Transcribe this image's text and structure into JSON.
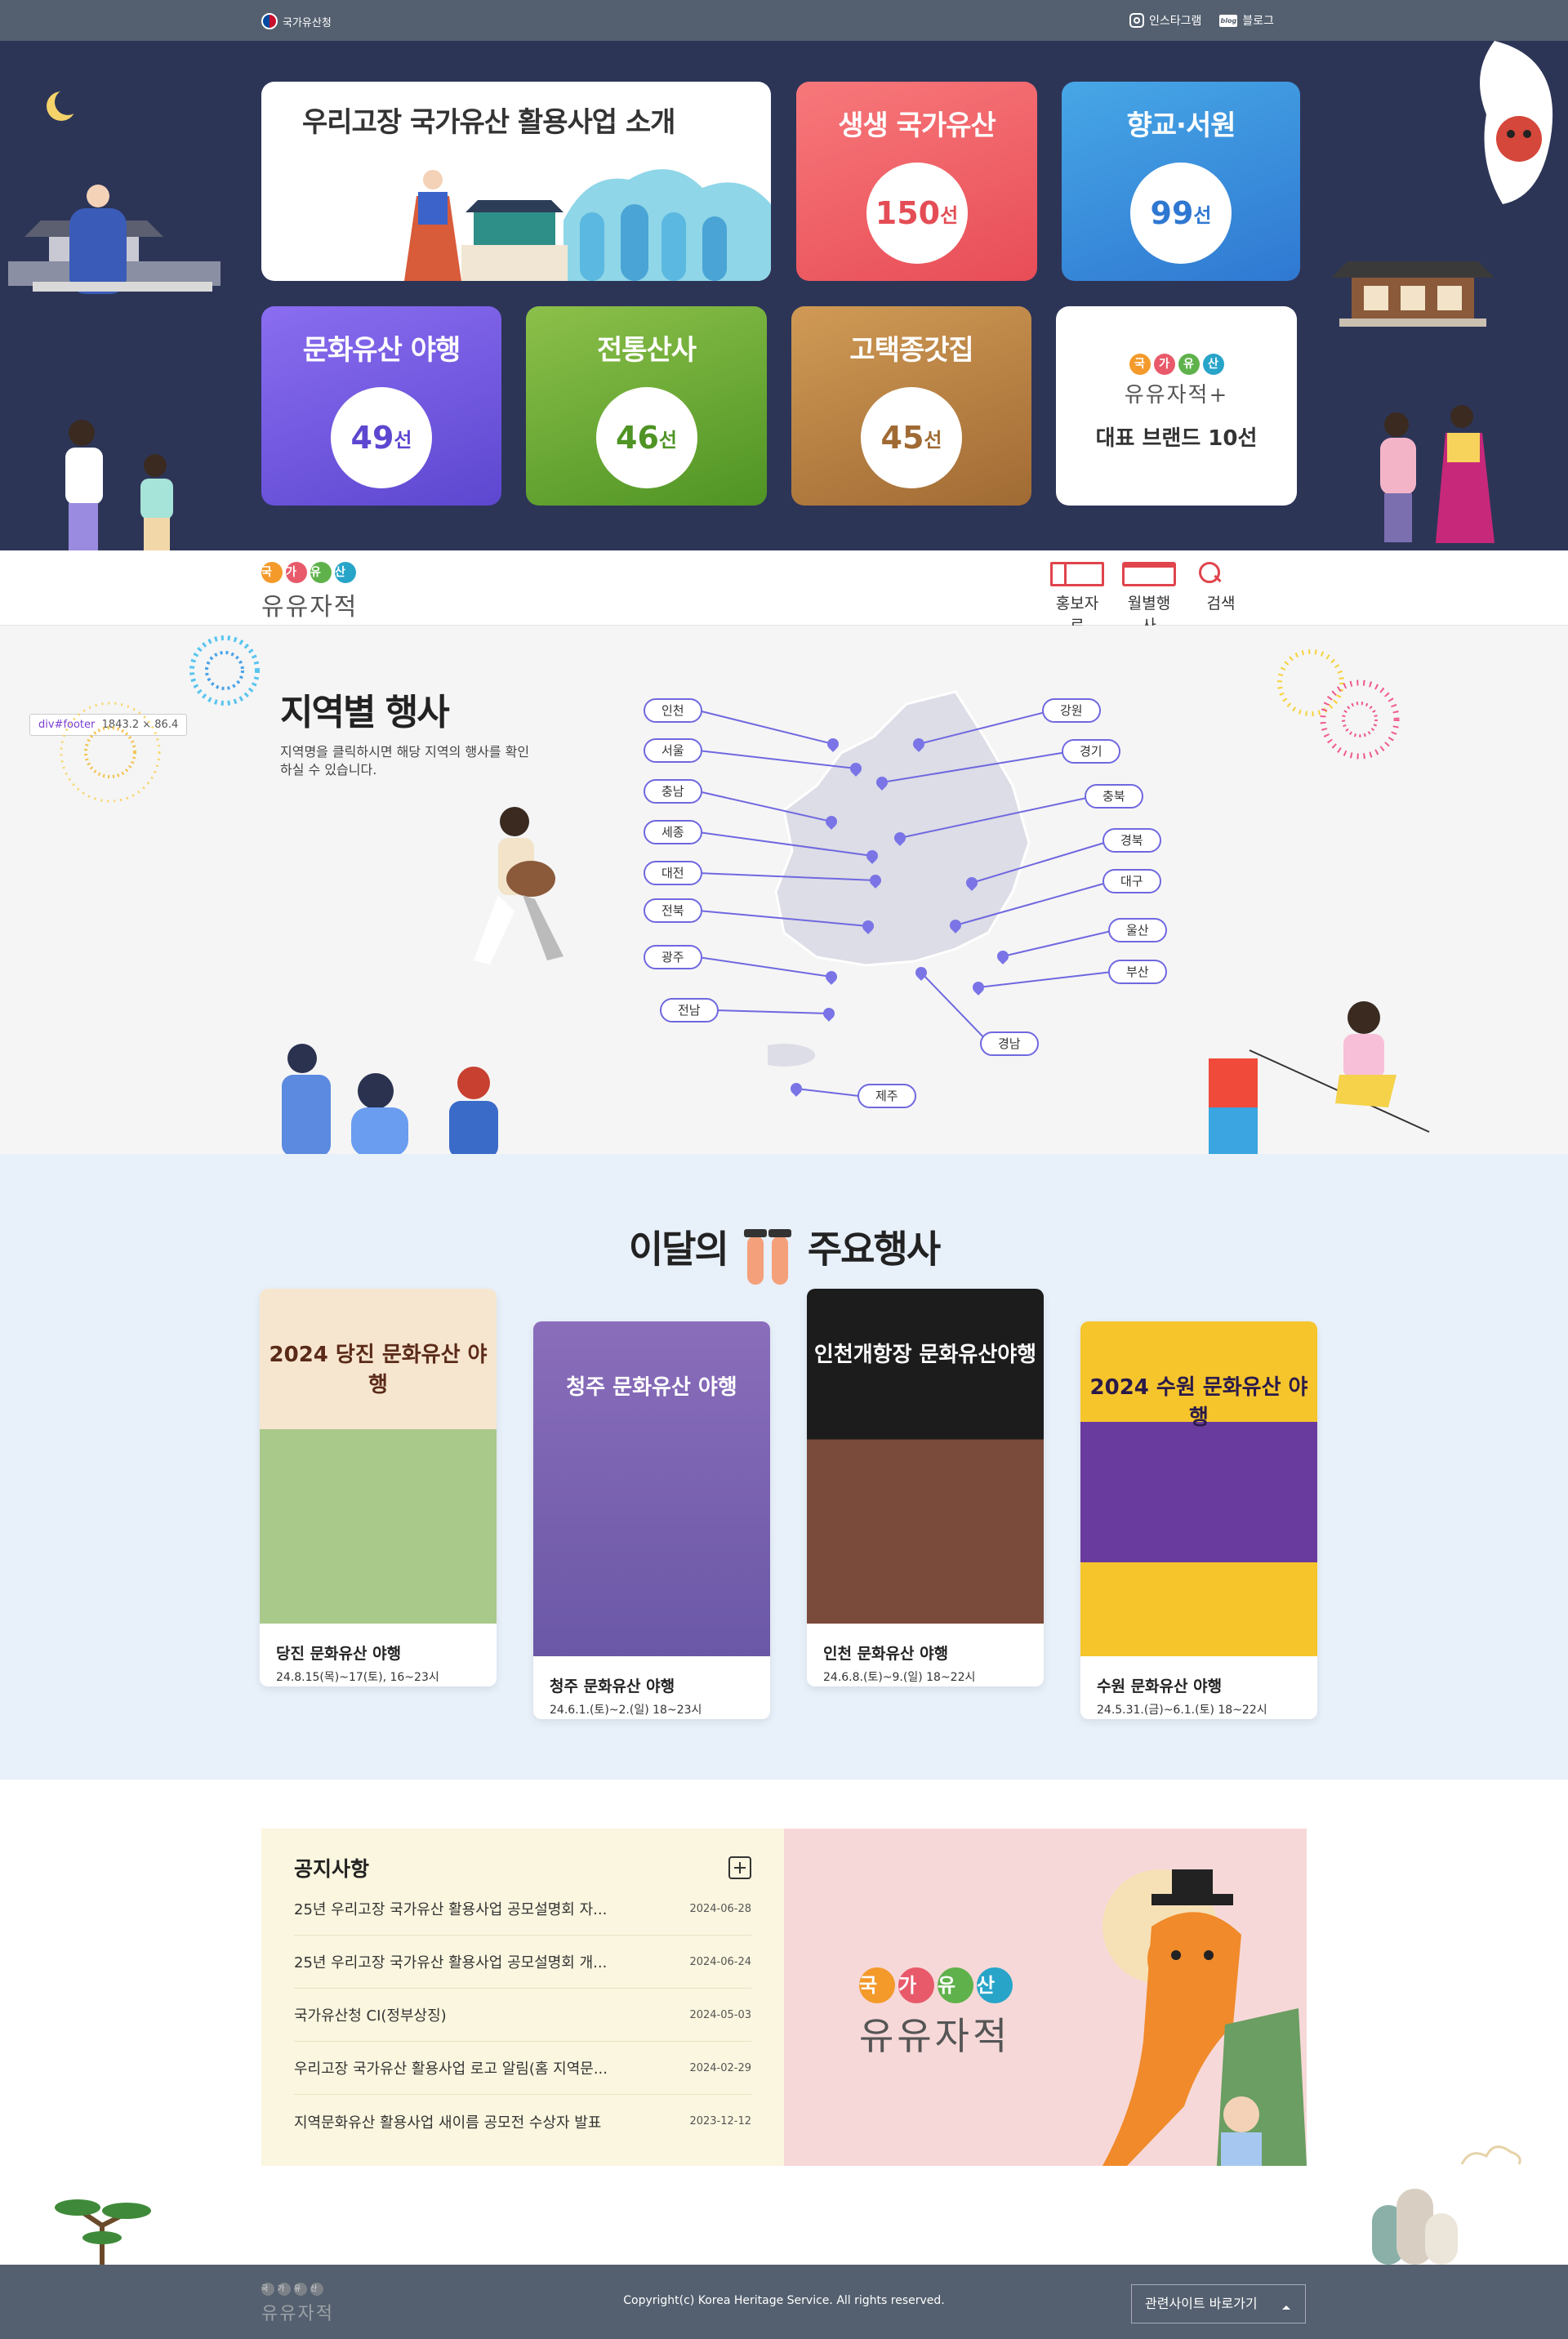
{
  "topbar": {
    "gov_label": "국가유산청",
    "instagram": "인스타그램",
    "blog": "블로그",
    "blog_mark": "blog"
  },
  "hero": {
    "intro": "우리고장 국가유산 활용사업 소개",
    "cards": [
      {
        "title": "생생 국가유산",
        "num": "150",
        "unit": "선"
      },
      {
        "title": "향교·서원",
        "num": "99",
        "unit": "선"
      },
      {
        "title": "문화유산 야행",
        "num": "49",
        "unit": "선"
      },
      {
        "title": "전통산사",
        "num": "46",
        "unit": "선"
      },
      {
        "title": "고택종갓집",
        "num": "45",
        "unit": "선"
      }
    ],
    "brand_dots": [
      "국",
      "가",
      "유",
      "산"
    ],
    "brand_word": "유유자적",
    "brand_plus": "+",
    "brand_title": "대표 브랜드 10선"
  },
  "nav": {
    "logo_dots": [
      "국",
      "가",
      "유",
      "산"
    ],
    "logo_word": "유유자적",
    "items": [
      "홍보자료",
      "월별행사",
      "검색"
    ]
  },
  "region": {
    "title": "지역별 행사",
    "desc": "지역명을 클릭하시면 해당 지역의 행사를 확인하실 수 있습니다.",
    "inspector": {
      "tag": "div#footer",
      "size": "1843.2 × 86.4"
    },
    "regions": [
      "인천",
      "서울",
      "충남",
      "세종",
      "대전",
      "전북",
      "광주",
      "전남",
      "강원",
      "경기",
      "충북",
      "경북",
      "대구",
      "울산",
      "부산",
      "경남",
      "제주"
    ]
  },
  "events": {
    "title_left": "이달의",
    "title_right": "주요행사",
    "items": [
      {
        "name": "당진 문화유산 야행",
        "date": "24.8.15(목)~17(토), 16~23시",
        "poster": "2024 당진 문화유산 야행"
      },
      {
        "name": "청주 문화유산 야행",
        "date": "24.6.1.(토)~2.(일) 18~23시",
        "poster": "청주 문화유산 야행"
      },
      {
        "name": "인천 문화유산 야행",
        "date": "24.6.8.(토)~9.(일) 18~22시",
        "poster": "인천개항장 문화유산야행"
      },
      {
        "name": "수원 문화유산 야행",
        "date": "24.5.31.(금)~6.1.(토) 18~22시",
        "poster": "2024 수원 문화유산 야행"
      }
    ]
  },
  "notice": {
    "title": "공지사항",
    "rows": [
      {
        "t": "25년 우리고장 국가유산 활용사업 공모설명회 자...",
        "d": "2024-06-28"
      },
      {
        "t": "25년 우리고장 국가유산 활용사업 공모설명회 개...",
        "d": "2024-06-24"
      },
      {
        "t": "국가유산청 CI(정부상징)",
        "d": "2024-05-03"
      },
      {
        "t": "우리고장 국가유산 활용사업 로고 알림(홈 지역문...",
        "d": "2024-02-29"
      },
      {
        "t": "지역문화유산 활용사업 새이름 공모전 수상자 발표",
        "d": "2023-12-12"
      }
    ]
  },
  "promo": {
    "dots": [
      "국",
      "가",
      "유",
      "산"
    ],
    "word": "유유자적"
  },
  "footer": {
    "logo_dots": [
      "국",
      "가",
      "유",
      "산"
    ],
    "logo_word": "유유자적",
    "copyright": "Copyright(c) Korea Heritage Service. All rights reserved.",
    "related": "관련사이트 바로가기"
  },
  "colors": {
    "hero_bg": "#2d3557",
    "topbar": "#54606f",
    "accent": "#e0444c",
    "map_line": "#6f68e0"
  }
}
